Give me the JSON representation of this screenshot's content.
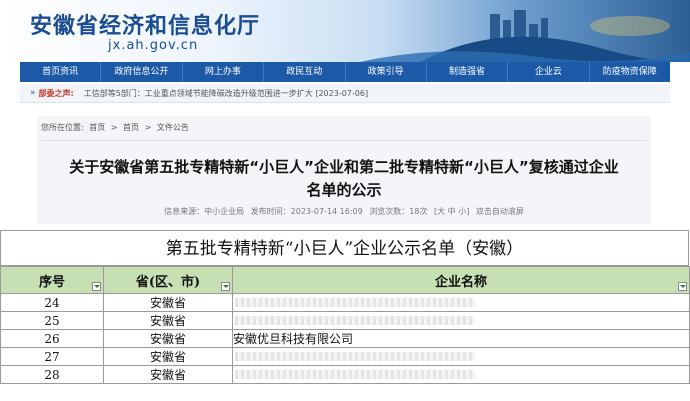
{
  "site": {
    "title": "安徽省经济和信息化厅",
    "url": "jx.ah.gov.cn"
  },
  "nav": [
    "首页资讯",
    "政府信息公开",
    "网上办事",
    "政民互动",
    "政策引导",
    "制造强省",
    "企业云",
    "防疫物资保障"
  ],
  "ticker": {
    "label": "部委之声:",
    "text": "工信部等5部门：工业重点领域节能降碳改造升级范围进一步扩大 [2023-07-06]"
  },
  "breadcrumb": [
    "您所在位置:",
    "首页",
    ">",
    "首页",
    ">",
    "文件公告"
  ],
  "article": {
    "title_line1": "关于安徽省第五批专精特新“小巨人”企业和第二批专精特新“小巨人”复核通过企业",
    "title_line2": "名单的公示",
    "meta": {
      "source": "信息来源：中小企业局",
      "published": "发布时间：2023-07-14 16:09",
      "views": "浏览次数：18次",
      "font_size": "[大 中 小]",
      "dblclick": "双击自动滚屏"
    }
  },
  "sheet": {
    "title": "第五批专精特新“小巨人”企业公示名单（安徽）",
    "columns": [
      "序号",
      "省(区、市)",
      "企业名称"
    ],
    "rows": [
      {
        "no": "24",
        "province": "安徽省",
        "company": ""
      },
      {
        "no": "25",
        "province": "安徽省",
        "company": ""
      },
      {
        "no": "26",
        "province": "安徽省",
        "company": "安徽优旦科技有限公司"
      },
      {
        "no": "27",
        "province": "安徽省",
        "company": ""
      },
      {
        "no": "28",
        "province": "安徽省",
        "company": ""
      }
    ]
  },
  "colors": {
    "brand_blue": "#1c5aa8",
    "header_green": "#c6e0b4",
    "ticker_red": "#c0392b"
  }
}
